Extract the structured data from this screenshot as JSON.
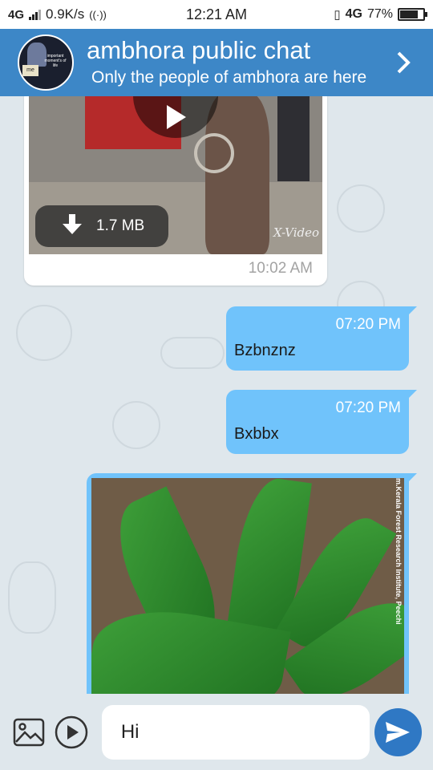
{
  "status_bar": {
    "network": "4G",
    "speed": "0.9K/s",
    "time": "12:21 AM",
    "lte_label": "4G",
    "battery": "77%",
    "battery_level": 0.77
  },
  "header": {
    "title": "ambhora public chat",
    "subtitle": "Only the people of ambhora are here",
    "avatar_caption": "important moment's of life",
    "avatar_tag": "me"
  },
  "messages": [
    {
      "type": "video",
      "direction": "in",
      "size": "1.7 MB",
      "watermark": "X-Video",
      "time": "10:02 AM"
    },
    {
      "type": "text",
      "direction": "out",
      "time": "07:20 PM",
      "text": "Bzbnznz"
    },
    {
      "type": "text",
      "direction": "out",
      "time": "07:20 PM",
      "text": "Bxbbx"
    },
    {
      "type": "photo",
      "direction": "out",
      "credit": "m.Kerala Forest Research Institute, Peechi"
    }
  ],
  "composer": {
    "input_value": "Hi",
    "gallery_icon": "image-icon",
    "video_icon": "play-circle-icon",
    "send_icon": "send-icon"
  },
  "colors": {
    "header": "#3d87c7",
    "outgoing_bubble": "#70c3fb",
    "incoming_bubble": "#ffffff",
    "send_button": "#2f78c4",
    "background": "#dfe7ec"
  }
}
